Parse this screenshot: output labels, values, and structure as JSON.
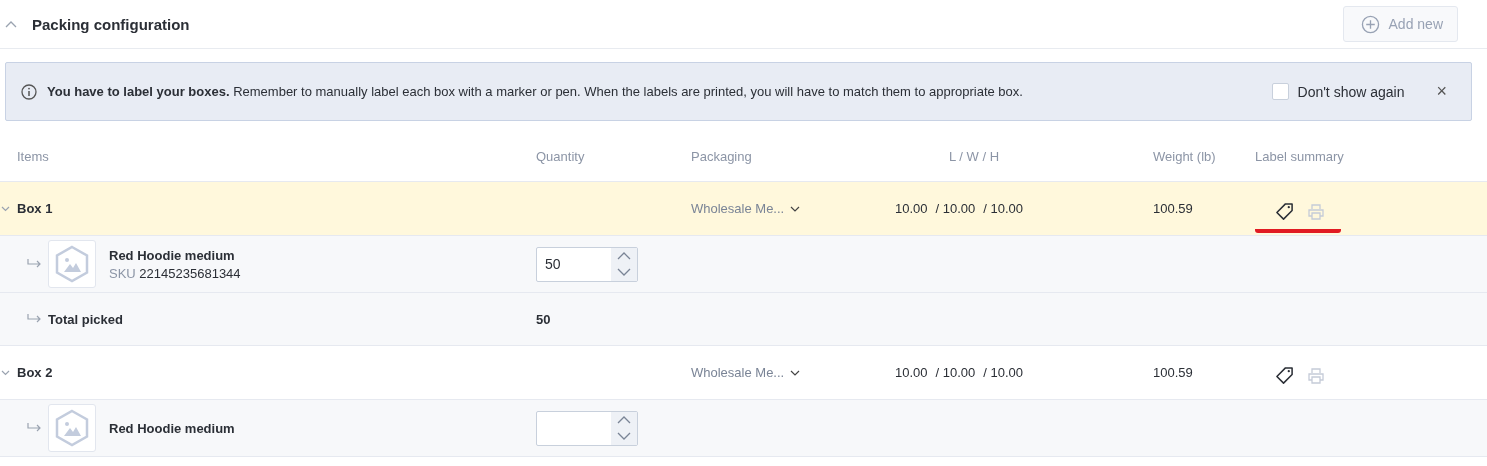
{
  "section": {
    "title": "Packing configuration",
    "expanded": true,
    "add_button": {
      "label": "Add new",
      "disabled": true
    }
  },
  "notice": {
    "text": "**You have to label your boxes.** Remember to manually label each box with a marker or pen. When the labels are printed, you will have to match them to appropriate box.",
    "checkbox": {
      "label": "Don't show again",
      "checked": false
    },
    "close": "×"
  },
  "table": {
    "columns": [
      "Items",
      "Quantity",
      "Packaging",
      "L / W / H",
      "Weight (lb)",
      "Label summary"
    ],
    "boxes": [
      {
        "name": "Box 1",
        "selected": true,
        "expanded": true,
        "packaging": "Wholesale Me...",
        "length": "10.00",
        "width": "/ 10.00",
        "height": "/ 10.00",
        "weight": "100.59",
        "underlined": true,
        "items": [
          {
            "name": "Red Hoodie medium",
            "sku_label": "SKU",
            "sku": "22145235681344",
            "quantity": "50"
          }
        ],
        "total": {
          "label": "Total picked",
          "value": "50"
        }
      },
      {
        "name": "Box 2",
        "selected": false,
        "expanded": true,
        "packaging": "Wholesale Me...",
        "length": "10.00",
        "width": "/ 10.00",
        "height": "/ 10.00",
        "weight": "100.59",
        "underlined": false,
        "items": [
          {
            "name": "Red Hoodie medium"
          }
        ]
      }
    ]
  }
}
